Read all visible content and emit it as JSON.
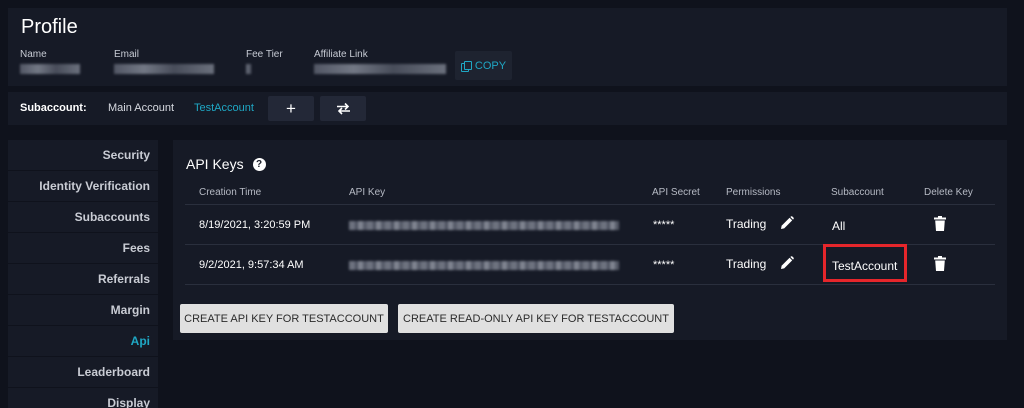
{
  "profile": {
    "title": "Profile",
    "fields": [
      {
        "label": "Name"
      },
      {
        "label": "Email"
      },
      {
        "label": "Fee Tier"
      },
      {
        "label": "Affiliate Link"
      }
    ],
    "copy_label": "COPY"
  },
  "subaccount": {
    "label": "Subaccount:",
    "options": [
      "Main Account",
      "TestAccount"
    ],
    "selected": "TestAccount",
    "add_icon": "plus-icon",
    "switch_icon": "swap-arrows-icon"
  },
  "sidebar": {
    "items": [
      {
        "label": "Security"
      },
      {
        "label": "Identity Verification"
      },
      {
        "label": "Subaccounts"
      },
      {
        "label": "Fees"
      },
      {
        "label": "Referrals"
      },
      {
        "label": "Margin"
      },
      {
        "label": "Api",
        "active": true
      },
      {
        "label": "Leaderboard"
      },
      {
        "label": "Display"
      }
    ]
  },
  "api_keys": {
    "title": "API Keys",
    "headers": [
      "Creation Time",
      "API Key",
      "API Secret",
      "Permissions",
      "Subaccount",
      "Delete Key"
    ],
    "rows": [
      {
        "created": "8/19/2021, 3:20:59 PM",
        "secret": "*****",
        "permissions": "Trading",
        "subaccount": "All"
      },
      {
        "created": "9/2/2021, 9:57:34 AM",
        "secret": "*****",
        "permissions": "Trading",
        "subaccount": "TestAccount"
      }
    ],
    "buttons": {
      "create": "CREATE API KEY FOR TESTACCOUNT",
      "create_readonly": "CREATE READ-ONLY API KEY FOR TESTACCOUNT"
    }
  },
  "colors": {
    "accent": "#1fa7c4",
    "highlight": "#e6262b",
    "background": "#0f121c",
    "panel": "#161a26"
  }
}
